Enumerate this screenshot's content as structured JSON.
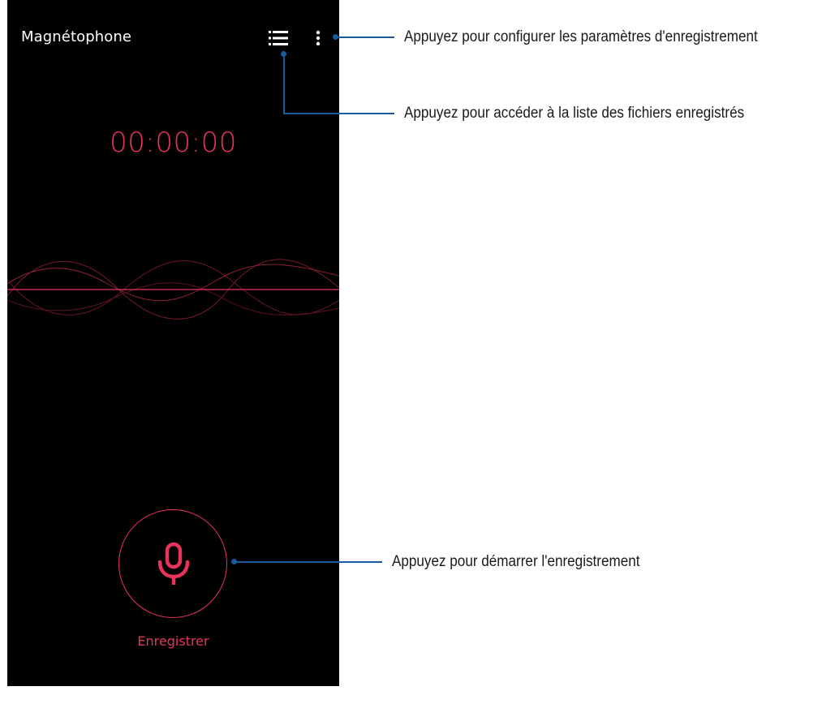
{
  "app": {
    "title": "Magnétophone",
    "timer": "00:00:00",
    "record_label": "Enregistrer",
    "accent_color": "#e8345b",
    "background_color": "#000000"
  },
  "toolbar": {
    "list_icon": "list-icon",
    "more_icon": "more-options-icon"
  },
  "record_button": {
    "icon": "microphone-icon"
  },
  "callouts": {
    "settings": "Appuyez pour configurer les paramètres d'enregistrement",
    "file_list": "Appuyez pour accéder à la liste des fichiers enregistrés",
    "start_recording": "Appuyez pour démarrer l'enregistrement",
    "line_color": "#1a5a9a"
  }
}
